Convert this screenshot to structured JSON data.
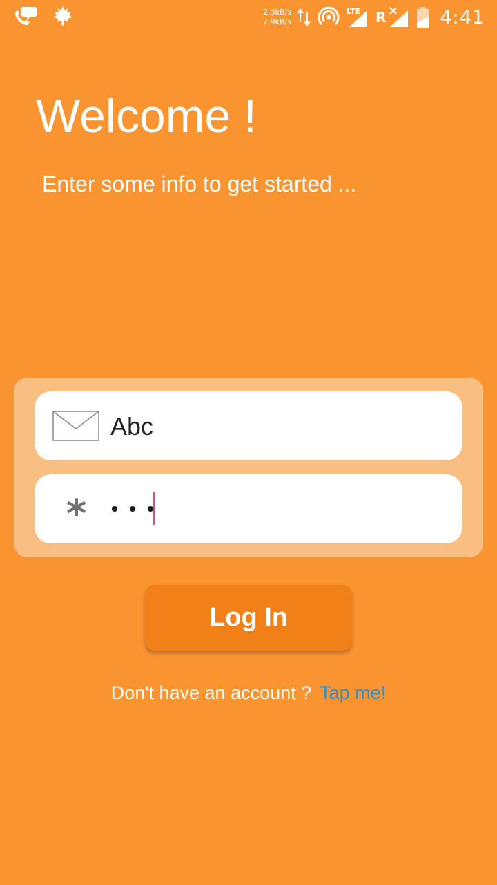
{
  "status_bar": {
    "speed_up": "2.3kB/s",
    "speed_down": "7.9kB/s",
    "network_type": "LTE",
    "roaming": "R",
    "time": "4:41",
    "icons": [
      "chat-call-icon",
      "leaf-icon",
      "data-arrows-icon",
      "hotspot-icon",
      "lte-signal-icon",
      "no-signal-icon",
      "battery-icon"
    ]
  },
  "header": {
    "title": "Welcome !",
    "subtitle": "Enter some info to get started ..."
  },
  "form": {
    "email_value": "Abc",
    "email_icon": "mail-icon",
    "password_icon": "asterisk-icon",
    "password_masked_length": 3
  },
  "login_button": {
    "label": "Log In"
  },
  "signup": {
    "text": "Don't have an account ?",
    "link": "Tap me!"
  },
  "colors": {
    "background": "#F99431",
    "card": "#F9BE82",
    "button": "#F28018",
    "link": "#2B8FD0",
    "cursor": "#E4487B"
  }
}
